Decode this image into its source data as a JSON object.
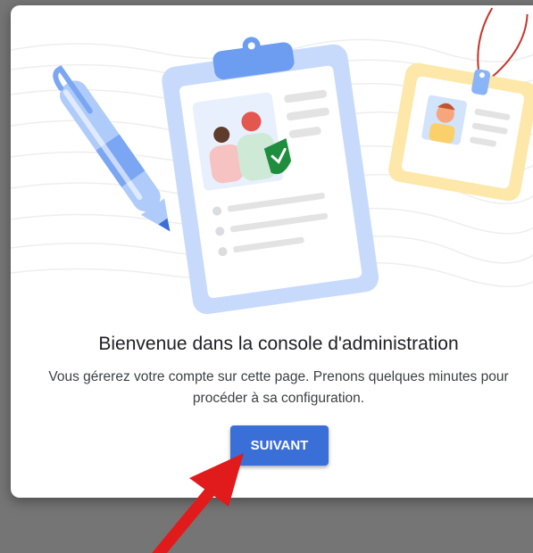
{
  "dialog": {
    "title": "Bienvenue dans la console d'administration",
    "description": "Vous gérerez votre compte sur cette page. Prenons quelques minutes pour procéder à sa configuration.",
    "next_label": "SUIVANT"
  },
  "colors": {
    "primary_button": "#3b6fd8",
    "arrow": "#e11b1b",
    "clipboard": "#c8dafb",
    "check_badge": "#1e8e3e"
  },
  "icons": [
    "pen-icon",
    "clipboard-icon",
    "id-badge-icon",
    "shield-check-icon",
    "annotation-arrow-icon"
  ]
}
